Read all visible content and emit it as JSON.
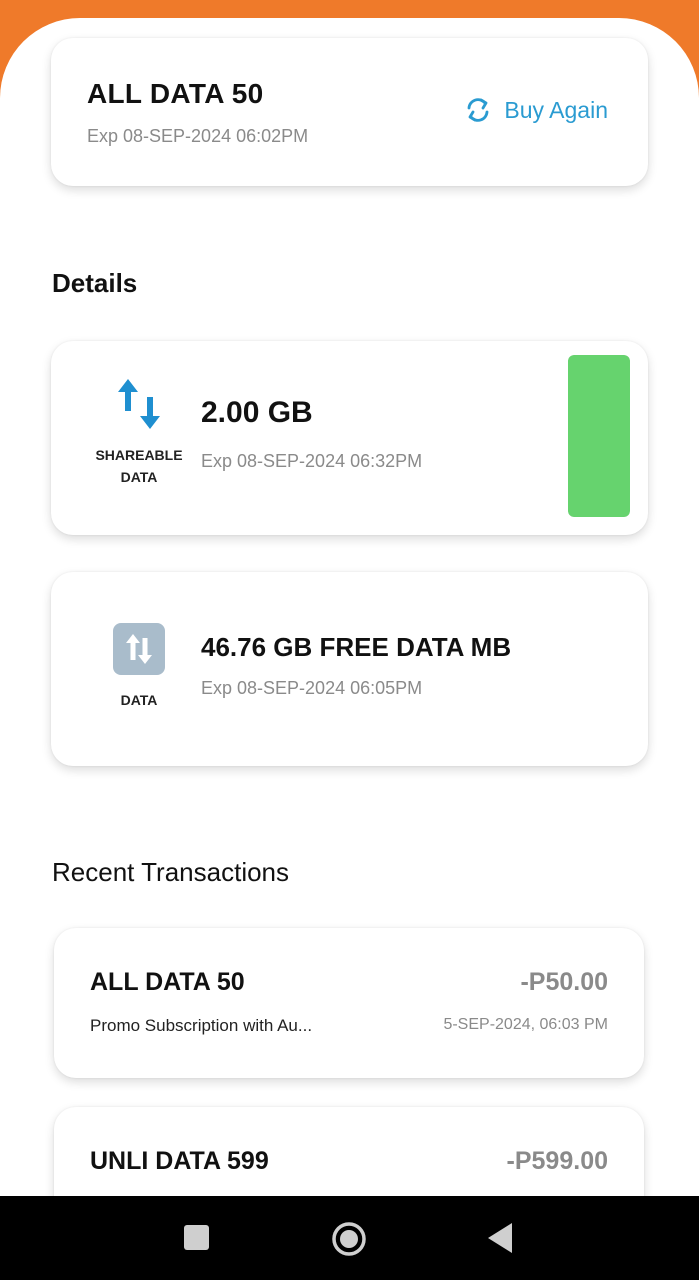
{
  "plan": {
    "name": "ALL DATA 50",
    "expiry": "Exp 08-SEP-2024 06:02PM",
    "buy_again_label": "Buy Again"
  },
  "details": {
    "title": "Details",
    "items": [
      {
        "icon": "shareable-data-arrows-icon",
        "caption_line1": "SHAREABLE",
        "caption_line2": "DATA",
        "amount": "2.00 GB",
        "expiry": "Exp 08-SEP-2024 06:32PM",
        "remaining_fraction": 1.0
      },
      {
        "icon": "data-arrows-icon",
        "caption_line1": "DATA",
        "amount": "46.76 GB FREE DATA MB",
        "expiry": "Exp 08-SEP-2024 06:05PM"
      }
    ]
  },
  "recent": {
    "title": "Recent Transactions",
    "items": [
      {
        "name": "ALL DATA 50",
        "amount": "-P50.00",
        "description": "Promo Subscription with Au...",
        "date": "5-SEP-2024, 06:03 PM"
      },
      {
        "name": "UNLI DATA 599",
        "amount": "-P599.00"
      }
    ]
  },
  "colors": {
    "brand_orange": "#ef7a2a",
    "accent_blue": "#2a9bd1",
    "usage_green": "#66d36e"
  },
  "navigation": {
    "buttons": [
      "recents-square-icon",
      "home-circle-icon",
      "back-triangle-icon"
    ]
  }
}
